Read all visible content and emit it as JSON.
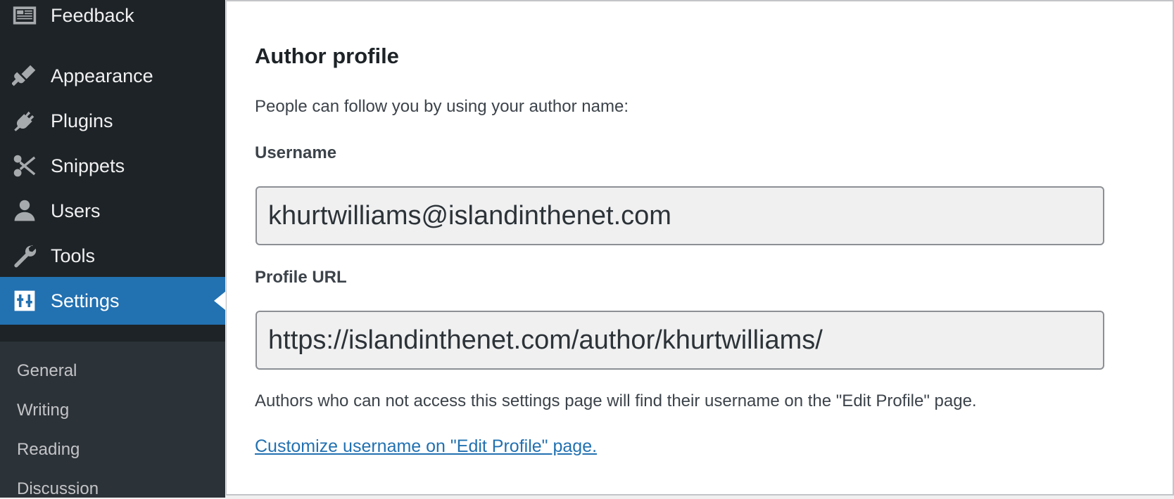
{
  "sidebar": {
    "menu": [
      {
        "label": "Feedback",
        "icon": "feedback-icon"
      },
      {
        "label": "Appearance",
        "icon": "paintbrush-icon"
      },
      {
        "label": "Plugins",
        "icon": "plug-icon"
      },
      {
        "label": "Snippets",
        "icon": "scissors-icon"
      },
      {
        "label": "Users",
        "icon": "user-icon"
      },
      {
        "label": "Tools",
        "icon": "wrench-icon"
      },
      {
        "label": "Settings",
        "icon": "settings-sliders-icon",
        "active": true
      }
    ],
    "submenu": [
      {
        "label": "General"
      },
      {
        "label": "Writing"
      },
      {
        "label": "Reading"
      },
      {
        "label": "Discussion"
      }
    ],
    "colors": {
      "background": "#1d2327",
      "active": "#2271b1",
      "submenu_bg": "#2c3338"
    }
  },
  "panel": {
    "title": "Author profile",
    "intro": "People can follow you by using your author name:",
    "username_label": "Username",
    "username_value": "khurtwilliams@islandinthenet.com",
    "profile_url_label": "Profile URL",
    "profile_url_value": "https://islandinthenet.com/author/khurtwilliams/",
    "note": "Authors who can not access this settings page will find their username on the \"Edit Profile\" page.",
    "link_text": "Customize username on \"Edit Profile\" page.",
    "link_color": "#2271b1"
  }
}
